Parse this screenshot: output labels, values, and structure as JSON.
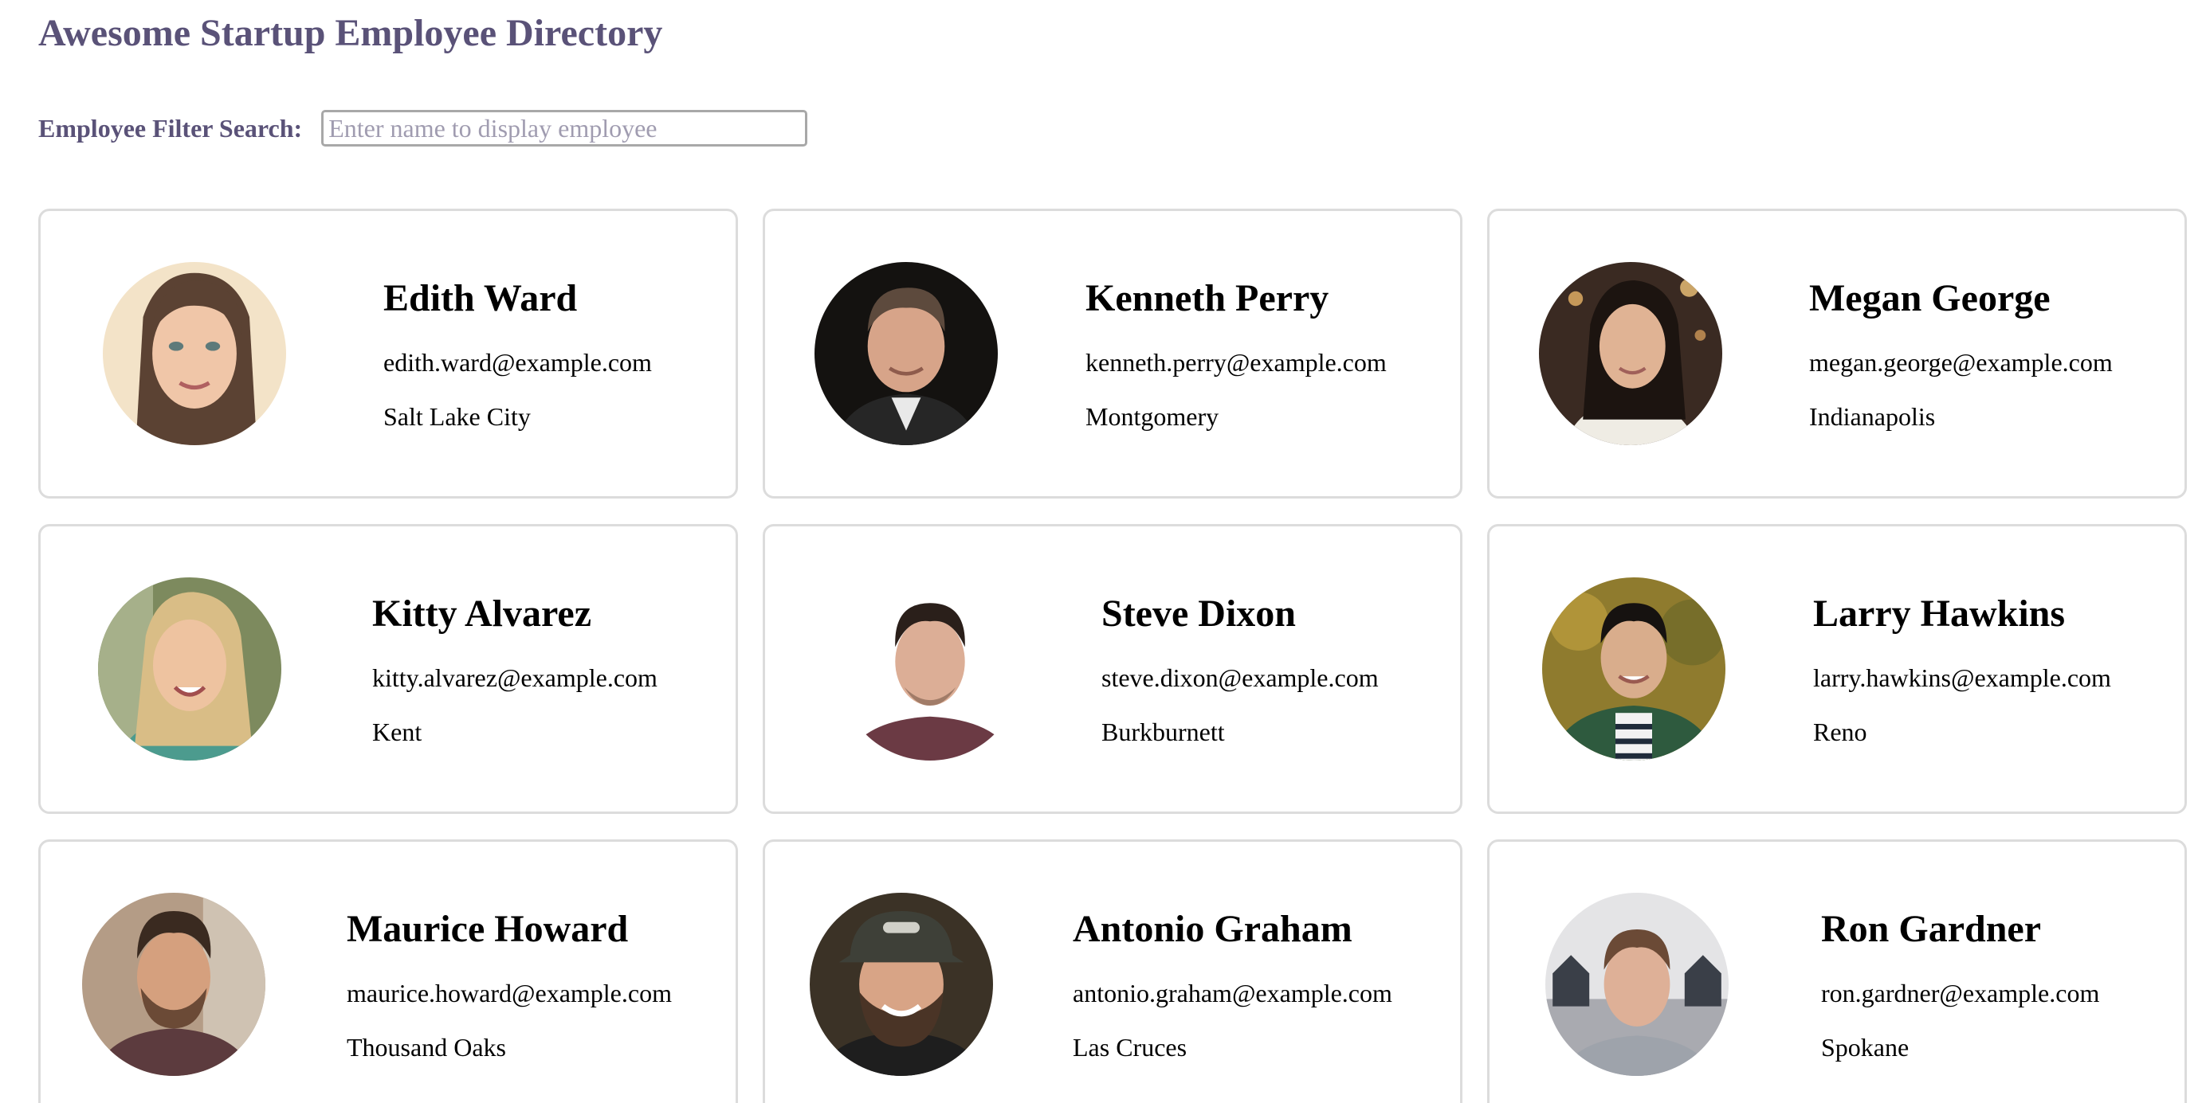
{
  "header": {
    "title": "Awesome Startup Employee Directory"
  },
  "search": {
    "label": "Employee Filter Search:",
    "placeholder": "Enter name to display employee",
    "value": ""
  },
  "employees": [
    {
      "name": "Edith Ward",
      "email": "edith.ward@example.com",
      "city": "Salt Lake City"
    },
    {
      "name": "Kenneth Perry",
      "email": "kenneth.perry@example.com",
      "city": "Montgomery"
    },
    {
      "name": "Megan George",
      "email": "megan.george@example.com",
      "city": "Indianapolis"
    },
    {
      "name": "Kitty Alvarez",
      "email": "kitty.alvarez@example.com",
      "city": "Kent"
    },
    {
      "name": "Steve Dixon",
      "email": "steve.dixon@example.com",
      "city": "Burkburnett"
    },
    {
      "name": "Larry Hawkins",
      "email": "larry.hawkins@example.com",
      "city": "Reno"
    },
    {
      "name": "Maurice Howard",
      "email": "maurice.howard@example.com",
      "city": "Thousand Oaks"
    },
    {
      "name": "Antonio Graham",
      "email": "antonio.graham@example.com",
      "city": "Las Cruces"
    },
    {
      "name": "Ron Gardner",
      "email": "ron.gardner@example.com",
      "city": "Spokane"
    }
  ],
  "theme": {
    "heading_color": "#5a5278",
    "card_border": "#dcdcdc"
  }
}
